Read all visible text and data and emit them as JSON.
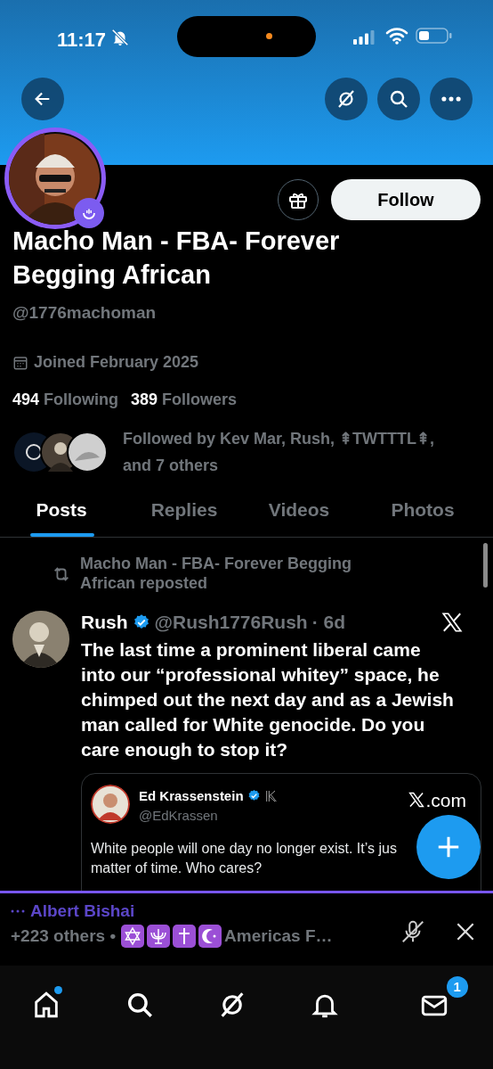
{
  "status_bar": {
    "time": "11:17",
    "silenced": true
  },
  "profile": {
    "name": "Macho Man - FBA- Forever Begging African",
    "handle": "@1776machoman",
    "joined": "Joined February 2025",
    "following_count": "494",
    "following_label": "Following",
    "followers_count": "389",
    "followers_label": "Followers",
    "followed_by": "Followed by Kev Mar, Rush, ⇞TWTTTL⇞, and 7 others",
    "follow_button": "Follow"
  },
  "tabs": [
    {
      "label": "Posts",
      "selected": true
    },
    {
      "label": "Replies",
      "selected": false
    },
    {
      "label": "Videos",
      "selected": false
    },
    {
      "label": "Photos",
      "selected": false
    }
  ],
  "post": {
    "repost_label": "Macho Man - FBA- Forever Begging African reposted",
    "author": "Rush",
    "verified": true,
    "handle": "@Rush1776Rush",
    "time": "· 6d",
    "text": "The last time a prominent liberal came into our “professional whitey” space, he chimped out the next day and as a Jewish man called for White genocide. Do you care enough to stop it?",
    "quote": {
      "author": "Ed Krassenstein",
      "verified": true,
      "handle": "@EdKrassen",
      "source": ".com",
      "text_lines": [
        "White people will one day no longer exist. It’s jus",
        "matter of time. Who cares?"
      ]
    }
  },
  "space_bar": {
    "host": "Albert Bishai",
    "others": "+223 others •",
    "title": "Americas F…"
  },
  "nav": [
    {
      "kind": "home",
      "dot": true
    },
    {
      "kind": "search"
    },
    {
      "kind": "grok"
    },
    {
      "kind": "bell"
    },
    {
      "kind": "mail",
      "badge": "1"
    }
  ]
}
